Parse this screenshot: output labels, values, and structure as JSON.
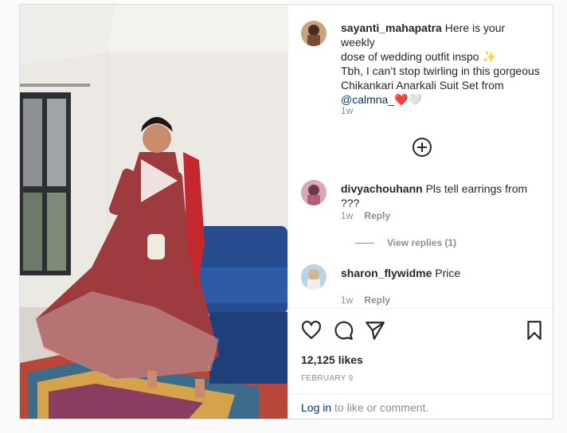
{
  "post": {
    "author": "sayanti_mahapatra",
    "caption_line1": "Here is your weekly",
    "caption_line2": "dose of wedding outfit inspo ✨",
    "caption_line3": "Tbh, I can’t stop twirling in this gorgeous",
    "caption_line4": "Chikankari Anarkali Suit Set from",
    "caption_mention": "@calmna_",
    "caption_emojis": "❤️🤍",
    "time": "1w"
  },
  "comments": [
    {
      "user": "divyachouhann",
      "text": "Pls tell earrings from ???",
      "time": "1w",
      "reply_label": "Reply",
      "view_replies": "View replies (1)"
    },
    {
      "user": "sharon_flywidme",
      "text": "Price",
      "time": "1w",
      "reply_label": "Reply"
    }
  ],
  "actions": {
    "likes": "12,125 likes",
    "date": "FEBRUARY 9"
  },
  "login": {
    "link": "Log in",
    "rest": " to like or comment."
  },
  "colors": {
    "link": "#00376b",
    "secondary": "#8e8e8e",
    "heart": "#ed1c24"
  }
}
